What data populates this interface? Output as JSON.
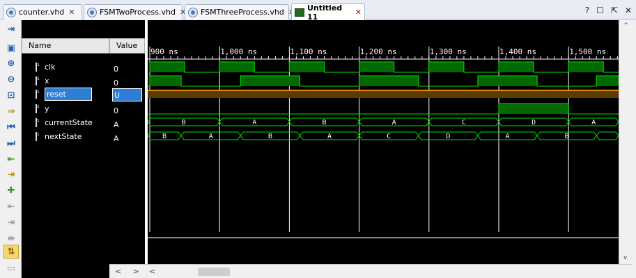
{
  "tabs": [
    {
      "label": "counter.vhd",
      "icon": "vhdl-file-icon",
      "active": false
    },
    {
      "label": "FSMTwoProcess.vhd",
      "icon": "vhdl-file-icon",
      "active": false
    },
    {
      "label": "FSMThreeProcess.vhd",
      "icon": "vhdl-file-icon",
      "active": false
    },
    {
      "label": "Untitled 11",
      "icon": "waveform-icon",
      "active": true
    }
  ],
  "tab_close_glyph": "✕",
  "window_controls": {
    "help": "?",
    "restore": "☐",
    "float": "⇱",
    "close": "✕"
  },
  "columns": {
    "name": "Name",
    "value": "Value"
  },
  "signals": [
    {
      "name": "clk",
      "value": "0",
      "selected": false
    },
    {
      "name": "x",
      "value": "0",
      "selected": false
    },
    {
      "name": "reset",
      "value": "U",
      "selected": true
    },
    {
      "name": "y",
      "value": "0",
      "selected": false
    },
    {
      "name": "currentState",
      "value": "A",
      "selected": false
    },
    {
      "name": "nextState",
      "value": "A",
      "selected": false
    }
  ],
  "timeline": {
    "labels": [
      "900 ns",
      "1,000 ns",
      "1,100 ns",
      "1,200 ns",
      "1,300 ns",
      "1,400 ns",
      "1,500 ns"
    ]
  },
  "states": {
    "currentState": [
      "B",
      "A",
      "B",
      "A",
      "C",
      "D",
      "A"
    ],
    "nextState": [
      "B",
      "A",
      "B",
      "A",
      "C",
      "D",
      "A",
      "B"
    ]
  },
  "scroll": {
    "left_arrow": "<",
    "right_arrow": ">",
    "up_arrow": "^",
    "down_arrow": "v"
  },
  "toolbar_icons": [
    "zoom-fit-icon",
    "save-icon",
    "zoom-in-icon",
    "zoom-out-icon",
    "zoom-full-icon",
    "goto-cursor-icon",
    "goto-start-icon",
    "goto-end-icon",
    "prev-transition-icon",
    "next-transition-icon",
    "add-marker-icon",
    "prev-marker-icon",
    "next-marker-icon",
    "swap-cursors-icon",
    "snap-to-transition-icon",
    "expand-icon"
  ],
  "colors": {
    "wave_green": "#00e000",
    "fill_green": "#006a00",
    "reset_orange": "#e08a00",
    "selection": "#2d7fd4"
  }
}
